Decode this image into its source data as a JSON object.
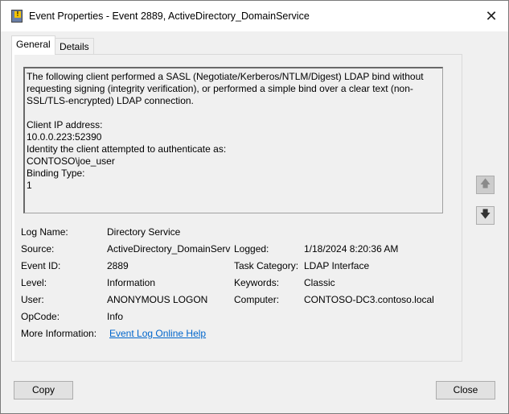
{
  "window": {
    "title": "Event Properties - Event 2889, ActiveDirectory_DomainService",
    "close": "✕"
  },
  "tabs": [
    {
      "label": "General"
    },
    {
      "label": "Details"
    }
  ],
  "description": "The following client performed a SASL (Negotiate/Kerberos/NTLM/Digest) LDAP bind without\nrequesting signing (integrity verification), or performed a simple bind over a clear text (non-\nSSL/TLS-encrypted) LDAP connection.\n\nClient IP address:\n10.0.0.223:52390\nIdentity the client attempted to authenticate as:\nCONTOSO\\joe_user\nBinding Type:\n1",
  "fields": {
    "log_name_label": "Log Name:",
    "log_name": "Directory Service",
    "source_label": "Source:",
    "source": "ActiveDirectory_DomainServ",
    "logged_label": "Logged:",
    "logged": "1/18/2024 8:20:36 AM",
    "event_id_label": "Event ID:",
    "event_id": "2889",
    "task_category_label": "Task Category:",
    "task_category": "LDAP Interface",
    "level_label": "Level:",
    "level": "Information",
    "keywords_label": "Keywords:",
    "keywords": "Classic",
    "user_label": "User:",
    "user": "ANONYMOUS LOGON",
    "computer_label": "Computer:",
    "computer": "CONTOSO-DC3.contoso.local",
    "opcode_label": "OpCode:",
    "opcode": "Info",
    "more_info_label": "More Information:",
    "more_info_link": "Event Log Online Help"
  },
  "nav": {
    "up": "🡅",
    "down": "🡇"
  },
  "buttons": {
    "copy": "Copy",
    "close": "Close"
  }
}
